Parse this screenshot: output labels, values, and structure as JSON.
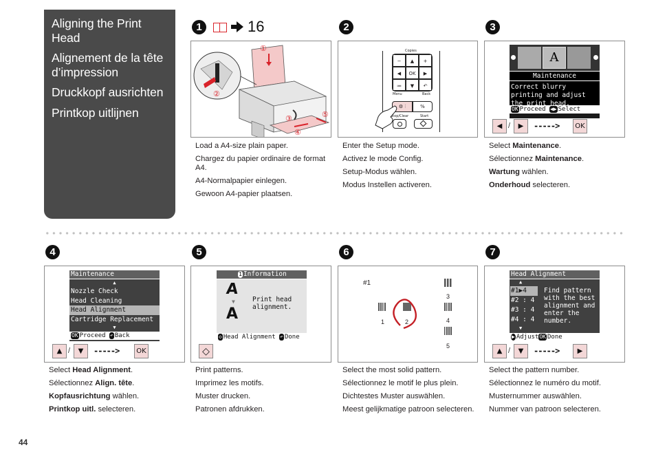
{
  "title_panel": {
    "titles": [
      "Aligning the Print Head",
      "Alignement de la tête d’impression",
      "Druckkopf ausrichten",
      "Printkop uitlijnen"
    ]
  },
  "step1": {
    "number": "1",
    "reference": {
      "icon": "book-icon",
      "arrow": "arrow-right-icon",
      "page": "16"
    },
    "figure_labels": [
      "①",
      "②",
      "③",
      "④",
      "⑤"
    ],
    "caption": [
      "Load a A4-size plain paper.",
      "Chargez du papier ordinaire de format A4.",
      "A4-Normalpapier einlegen.",
      "Gewoon A4-papier plaatsen."
    ]
  },
  "step2": {
    "number": "2",
    "panel": {
      "copies_label": "Copies",
      "keys": [
        "−",
        "▲",
        "+",
        "◀",
        "OK",
        "▶",
        "≔",
        "▼",
        "↶"
      ],
      "menu_label": "Menu",
      "back_label": "Back",
      "setup_key": "⚙ ⫶",
      "zoom_key": "%",
      "stop_label": "Stop/Clear",
      "start_label": "Start"
    },
    "caption": [
      "Enter the Setup mode.",
      "Activez le mode Config.",
      "Setup-Modus wählen.",
      "Modus Instellen activeren."
    ]
  },
  "step3": {
    "number": "3",
    "lcd": {
      "title": "Maintenance",
      "message": "Correct blurry printing and adjust the print head.",
      "footer_ok": "OK",
      "footer_proceed": "Proceed",
      "footer_select": "Select"
    },
    "buttons": [
      "◀",
      "▶",
      "OK"
    ],
    "caption": [
      {
        "pre": "Select ",
        "bold": "Maintenance",
        "post": "."
      },
      {
        "pre": "Sélectionnez ",
        "bold": "Maintenance",
        "post": "."
      },
      {
        "pre": "",
        "bold": "Wartung",
        "post": " wählen."
      },
      {
        "pre": "",
        "bold": "Onderhoud",
        "post": " selecteren."
      }
    ]
  },
  "step4": {
    "number": "4",
    "lcd": {
      "title": "Maintenance",
      "items": [
        "Nozzle Check",
        "Head Cleaning",
        "Head Alignment",
        "Cartridge Replacement"
      ],
      "selected_index": 2,
      "footer_ok": "OK",
      "footer_proceed": "Proceed",
      "footer_back": "Back"
    },
    "buttons": [
      "▲",
      "▼",
      "OK"
    ],
    "caption": [
      {
        "pre": "Select ",
        "bold": "Head Alignment",
        "post": "."
      },
      {
        "pre": "Sélectionnez ",
        "bold": "Align. tête",
        "post": "."
      },
      {
        "pre": "",
        "bold": "Kopfausrichtung",
        "post": " wählen."
      },
      {
        "pre": "",
        "bold": "Printkop uitl.",
        "post": " selecteren."
      }
    ]
  },
  "step5": {
    "number": "5",
    "lcd": {
      "title": "Information",
      "message": "Print head alignment.",
      "footer_start": "Head Alignment",
      "footer_done": "Done"
    },
    "buttons": [
      "◇"
    ],
    "caption": [
      "Print patterns.",
      "Imprimez les motifs.",
      "Muster drucken.",
      "Patronen afdrukken."
    ]
  },
  "step6": {
    "number": "6",
    "pattern_set": "#1",
    "patterns": [
      "1",
      "2",
      "3",
      "4",
      "5"
    ],
    "selected_pattern": "2",
    "caption": [
      "Select the most solid pattern.",
      "Sélectionnez le motif le plus plein.",
      "Dichtestes Muster auswählen.",
      "Meest gelijkmatige patroon selecteren."
    ]
  },
  "step7": {
    "number": "7",
    "lcd": {
      "title": "Head Alignment",
      "rows": [
        {
          "label": "#1",
          "value": "4"
        },
        {
          "label": "#2",
          "value": "4"
        },
        {
          "label": "#3",
          "value": "4"
        },
        {
          "label": "#4",
          "value": "4"
        }
      ],
      "message": "Find pattern with the best alignment and enter the number.",
      "footer_adjust": "Adjust",
      "footer_ok": "OK",
      "footer_done": "Done"
    },
    "buttons": [
      "▲",
      "▼",
      "▶"
    ],
    "caption": [
      "Select the pattern number.",
      "Sélectionnez le numéro du motif.",
      "Musternummer auswählen.",
      "Nummer van patroon selecteren."
    ]
  },
  "page_number": "44",
  "colors": {
    "panel": "#4a4a4a",
    "accent_red": "#d9232a",
    "button_pink": "#f3d7d7"
  }
}
